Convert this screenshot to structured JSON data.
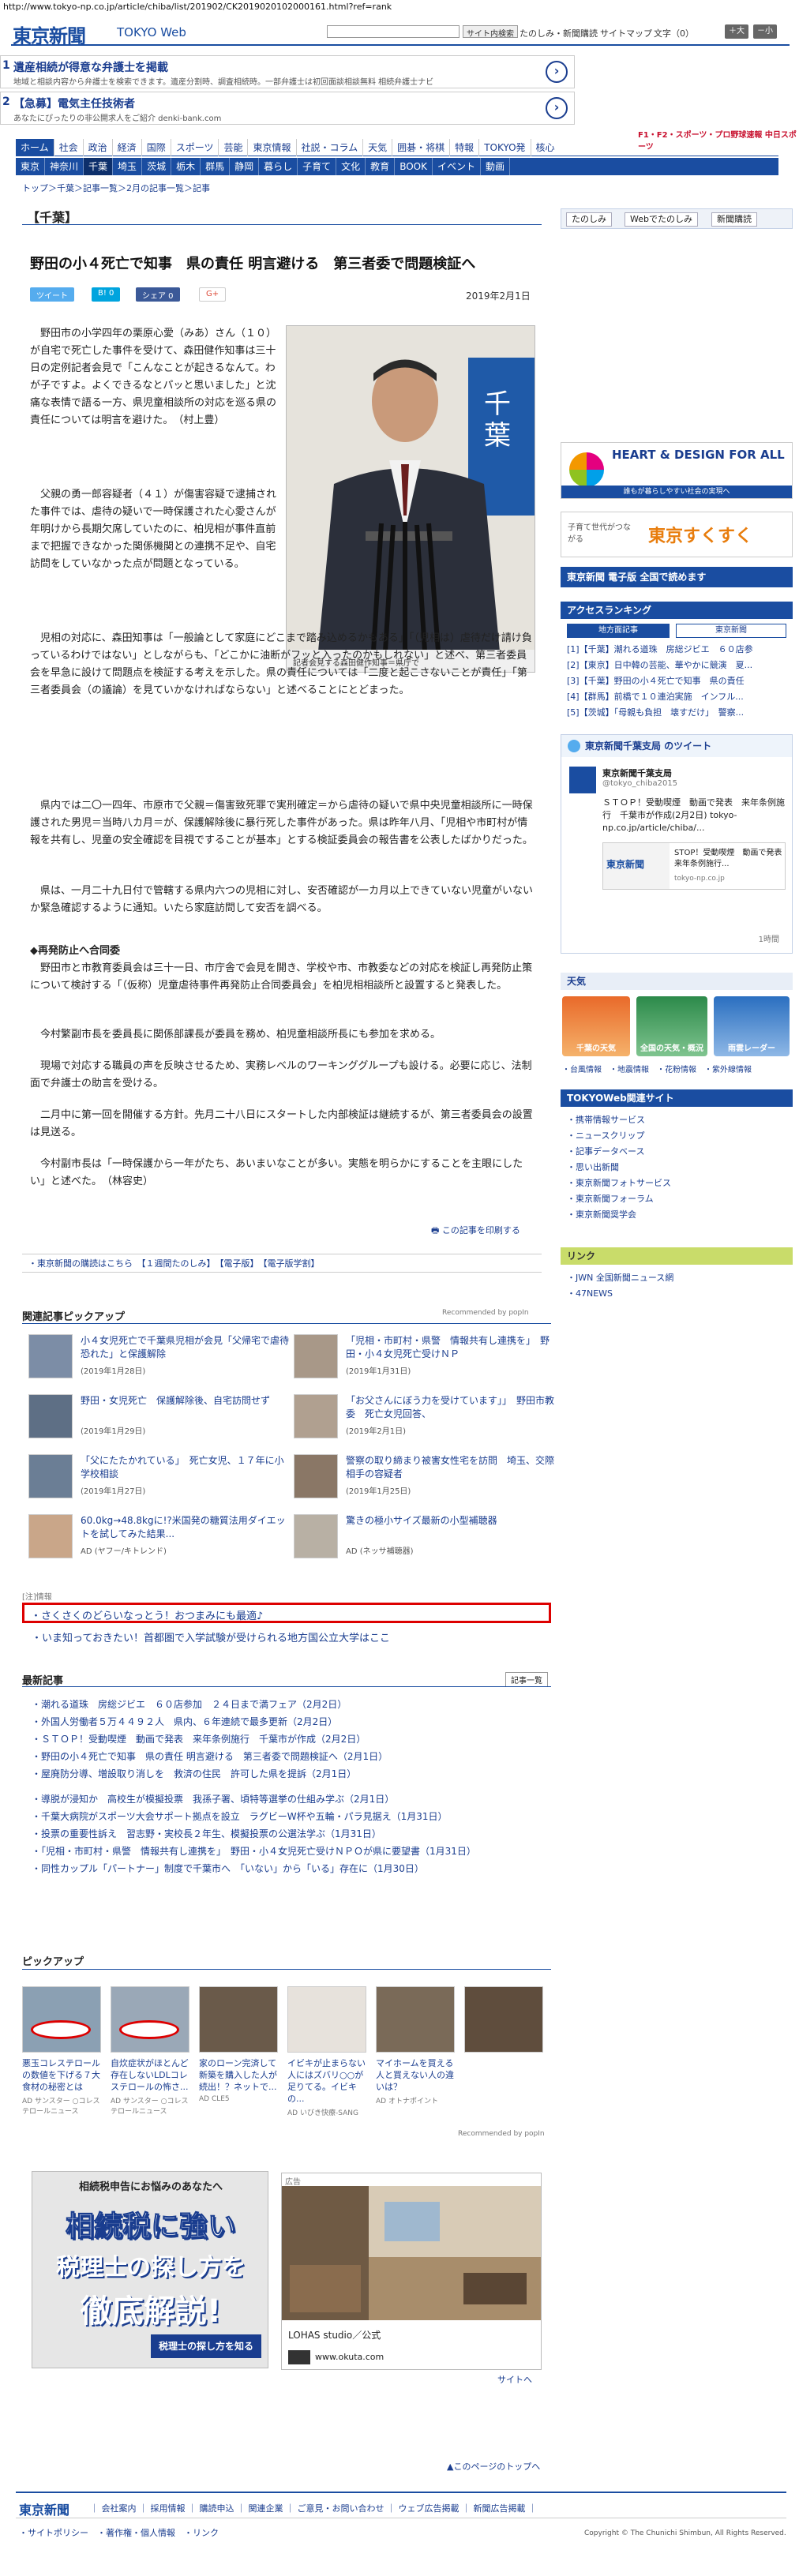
{
  "url": "http://www.tokyo-np.co.jp/article/chiba/list/201902/CK2019020102000161.html?ref=rank",
  "header": {
    "logo": "東京新聞",
    "logo_web": "TOKYO Web",
    "search_button": "サイト内検索",
    "links": "たのしみ・新聞購読",
    "sitemap": "サイトマップ",
    "font_label": "文字",
    "font_minus": "（0）",
    "font_large": "＋大",
    "font_small": "－小"
  },
  "ads_top": [
    {
      "num": "1",
      "title": "遺産相続が得意な弁護士を掲載",
      "sub": "地域と相談内容から弁護士を検索できます。遺産分割時、調査相続時。一部弁護士は初回面談相談無料 相続弁護士ナビ"
    },
    {
      "num": "2",
      "title": "【急募】電気主任技術者",
      "sub": "あなたにぴったりの非公開求人をご紹介 denki-bank.com"
    }
  ],
  "tochu": "F1・F2・スポーツ・プロ野球速報 中日スポーツ",
  "nav_primary": [
    "ホーム",
    "社会",
    "政治",
    "経済",
    "国際",
    "スポーツ",
    "芸能",
    "東京情報",
    "社説・コラム",
    "天気",
    "囲碁・将棋",
    "特報",
    "TOKYO発",
    "核心"
  ],
  "nav_secondary": [
    "東京",
    "神奈川",
    "千葉",
    "埼玉",
    "茨城",
    "栃木",
    "群馬",
    "静岡",
    "暮らし",
    "子育て",
    "文化",
    "教育",
    "BOOK",
    "イベント",
    "動画"
  ],
  "breadcrumb": "トップ＞千葉＞記事一覧＞2月の記事一覧＞記事",
  "section": "【千葉】",
  "article": {
    "title": "野田の小４死亡で知事　県の責任 明言避ける　第三者委で問題検証へ",
    "date": "2019年2月1日",
    "share_tweet": "ツイート",
    "share_b": "B! 0",
    "share_fb": "シェア 0",
    "share_g": "G+",
    "photo_caption": "記者会見する森田健作知事＝県庁で",
    "p1": "野田市の小学四年の栗原心愛（みあ）さん（１０）が自宅で死亡した事件を受けて、森田健作知事は三十日の定例記者会見で「こんなことが起きるなんて。わが子ですよ。よくできるなとパッと思いました」と沈痛な表情で語る一方、県児童相談所の対応を巡る県の責任については明言を避けた。　（村上豊）",
    "p2": "父親の勇一郎容疑者（４１）が傷害容疑で逮捕された事件では、虐待の疑いで一時保護された心愛さんが年明けから長期欠席していたのに、柏児相が事件直前まで把握できなかった関係機関との連携不足や、自宅訪問をしていなかった点が問題となっている。",
    "p3": "児相の対応に、森田知事は「一般論として家庭にどこまで踏み込めるかもある」「（児相は）虐待だけ請け負っているわけではない」としながらも、「どこかに油断がフッと入ったのかもしれない」と述べ、第三者委員会を早急に設けて問題点を検証する考えを示した。県の責任については「二度と起こさないことが責任」「第三者委員会（の議論）を見ていかなければならない」と述べることにとどまった。",
    "p4": "県内では二〇一四年、市原市で父親＝傷害致死罪で実刑確定＝から虐待の疑いで県中央児童相談所に一時保護された男児＝当時八カ月＝が、保護解除後に暴行死した事件があった。県は昨年八月、「児相や市町村が情報を共有し、児童の安全確認を目視ですることが基本」とする検証委員会の報告書を公表したばかりだった。",
    "p5": "県は、一月二十九日付で管轄する県内六つの児相に対し、安否確認が一カ月以上できていない児童がいないか緊急確認するように通知。いたら家庭訪問して安否を調べる。",
    "subhead": "◆再発防止へ合同委",
    "p6": "野田市と市教育委員会は三十一日、市庁舎で会見を開き、学校や市、市教委などの対応を検証し再発防止策について検討する「（仮称）児童虐待事件再発防止合同委員会」を柏児相相談所と設置すると発表した。",
    "p7": "今村繁副市長を委員長に関係部課長が委員を務め、柏児童相談所長にも参加を求める。",
    "p8": "現場で対応する職員の声を反映させるため、実務レベルのワーキンググループも設ける。必要に応じ、法制面で弁護士の助言を受ける。",
    "p9": "二月中に第一回を開催する方針。先月二十八日にスタートした内部検証は継続するが、第三者委員会の設置は見送る。",
    "p10": "今村副市長は「一時保護から一年がたち、あいまいなことが多い。実態を明らかにすることを主眼にしたい」と述べた。　（林容史）",
    "print": "この記事を印刷する"
  },
  "sublinks": "・東京新聞の購読はこちら　【１週間たのしみ】　【電子版】　【電子版学割】",
  "related": {
    "heading": "関連記事ピックアップ",
    "recommended": "Recommended by popIn",
    "items": [
      {
        "title": "小４女児死亡で千葉県児相が会見「父帰宅で虐待恐れた」と保護解除",
        "date": "(2019年1月28日)"
      },
      {
        "title": "「児相・市町村・県警　情報共有し連携を」　野田・小４女児死亡受けＮＰ",
        "date": "(2019年1月31日)"
      },
      {
        "title": "野田・女児死亡　保護解除後、自宅訪問せず",
        "date": "(2019年1月29日)"
      },
      {
        "title": "「お父さんにぼう力を受けています」」　野田市教委　死亡女児回答、",
        "date": "(2019年2月1日)"
      },
      {
        "title": "「父にたたかれている」　死亡女児、１７年に小学校相談",
        "date": "(2019年1月27日)"
      },
      {
        "title": "警察の取り締まり被害女性宅を訪問　埼玉、交際相手の容疑者",
        "date": "(2019年1月25日)"
      },
      {
        "title": "60.0kg→48.8kgに!?米国発の糖質法用ダイエットを試してみた結果...",
        "date": "AD (ヤフー/キトレンド)"
      },
      {
        "title": "驚きの極小サイズ最新の小型補聴器",
        "date": "AD (ネッサ補聴器)"
      }
    ]
  },
  "ad_label": "[注]情報",
  "ad_link1": "・さくさくのどらいなっとう！おつまみにも最適♪",
  "ad_link2": "・いま知っておきたい！首都圏で入学試験が受けられる地方国公立大学はここ",
  "latest": {
    "heading": "最新記事",
    "more": "記事一覧",
    "items": [
      "・潮れる道珠　房総ジビエ　６０店参加　２４日まで満フェア（2月2日）",
      "・外国人労働者５万４４９２人　県内、６年連続で最多更新（2月2日）",
      "・ＳＴＯＰ！受動喫煙　動画で発表　来年条例施行　千葉市が作成（2月2日）",
      "・野田の小４死亡で知事　県の責任 明言避ける　第三者委で問題検証へ（2月1日）",
      "・屋廃防分導、増設取り消しを　救済の住民　許可した県を提訴（2月1日）",
      "・導脱が浸知か　高校生が模擬投票　我孫子署、頃特等選挙の仕組み学ぶ（2月1日）",
      "・千葉大病院がスポーツ大会サポート拠点を設立　ラグビーW杯や五輪・パラ見据え（1月31日）",
      "・投票の重要性訴え　習志野・実校長２年生、模擬投票の公選法学ぶ（1月31日）",
      "・「児相・市町村・県警　情報共有し連携を」　野田・小４女児死亡受けＮＰＯが県に要望書（1月31日）",
      "・同性カップル「パートナー」制度で千葉市へ　「いない」から「いる」存在に（1月30日）"
    ]
  },
  "pickup": {
    "heading": "ピックアップ",
    "recommended": "Recommended by popIn",
    "items": [
      {
        "text": "悪玉コレステロールの数値を下げる７大食材の秘密とは",
        "src": "AD サンスター ○コレステロールニュース"
      },
      {
        "text": "自炊症状がほとんど存在しないLDLコレステロールの怖さ...",
        "src": "AD サンスター ○コレステロールニュース"
      },
      {
        "text": "家のローン完済して新築を購入した人が続出！？ネットで...",
        "src": "AD CLE5"
      },
      {
        "text": "イビキが止まらない人にはズバリ○○が足りてる。イビキの...",
        "src": "AD いびき快療-SANG"
      },
      {
        "text": "マイホームを買える人と買えない人の違いは？",
        "src": "AD オトナポイント"
      },
      {
        "text": "",
        "src": ""
      }
    ]
  },
  "bigad1": {
    "top": "相続税申告にお悩みのあなたへ",
    "big1": "相続税に強い",
    "big2": "税理士の探し方を",
    "big3": "徹底解説!",
    "foot": "税理士の探し方を知る"
  },
  "bigad2": {
    "label": "広告",
    "name": "LOHAS studio／公式",
    "site": "www.okuta.com"
  },
  "siteto": "サイトへ",
  "pagetop": "このページのトップへ",
  "footer": {
    "logo": "東京新聞",
    "links": "｜ 会社案内 ｜ 採用情報 ｜ 購読申込 ｜ 関連企業 ｜ ご意見・お問い合わせ ｜ ウェブ広告掲載 ｜ 新聞広告掲載 ｜",
    "links2": "・サイトポリシー　・著作権・個人情報　・リンク",
    "copyright": "Copyright © The Chunichi Shimbun, All Rights Reserved."
  },
  "right": {
    "btn1": "たのしみ",
    "btn2": "Webでたのしみ",
    "btn3": "新聞購読",
    "heart": "HEART & DESIGN FOR ALL",
    "heart_sub": "誰もが暮らしやすい社会の実現へ",
    "sukusuku_sub": "子育て世代がつながる",
    "sukusuku": "東京すくすく",
    "denshi": "東京新聞 電子版 全国で読めます",
    "ranking_head": "アクセスランキング",
    "rank_tab1": "地方面記事",
    "rank_tab2": "東京新聞",
    "ranking": [
      "[1]【千葉】潮れる道珠　房総ジビエ　６０店参",
      "[2]【東京】日中韓の芸能、華やかに競演　夏...",
      "[3]【千葉】野田の小４死亡で知事　県の責任",
      "[4]【群馬】前橋で１０連泊実施　インフル...",
      "[5]【茨城】「母親も負担　壊すだけ」　警察..."
    ],
    "twitter_head": "東京新聞千葉支局 のツイート",
    "twitter_name": "東京新聞千葉支局",
    "twitter_handle": "@tokyo_chiba2015",
    "twitter_text": "ＳＴＯＰ！受動喫煙　動画で発表　来年条例施行　千葉市が作成(2月2日) tokyo-np.co.jp/article/chiba/...",
    "twitter_card_title": "STOP！受動喫煙　動画で発表　来年条例施行...",
    "twitter_card_site": "tokyo-np.co.jp",
    "twitter_time": "1時間",
    "weather_head": "天気",
    "weather_items": [
      "千葉の天気",
      "全国の天気・概況",
      "雨雲レーダー"
    ],
    "weather_links": "・台風情報　・地震情報　・花粉情報　・紫外線情報",
    "related_sites_head": "TOKYOWeb関連サイト",
    "related_sites": [
      "・携帯情報サービス",
      "・ニュースクリップ",
      "・記事データベース",
      "・思い出新聞",
      "・東京新聞フォトサービス",
      "・東京新聞フォーラム",
      "・東京新聞奨学会"
    ],
    "link_head": "リンク",
    "links": [
      "・JWN 全国新聞ニュース網",
      "・47NEWS"
    ]
  }
}
